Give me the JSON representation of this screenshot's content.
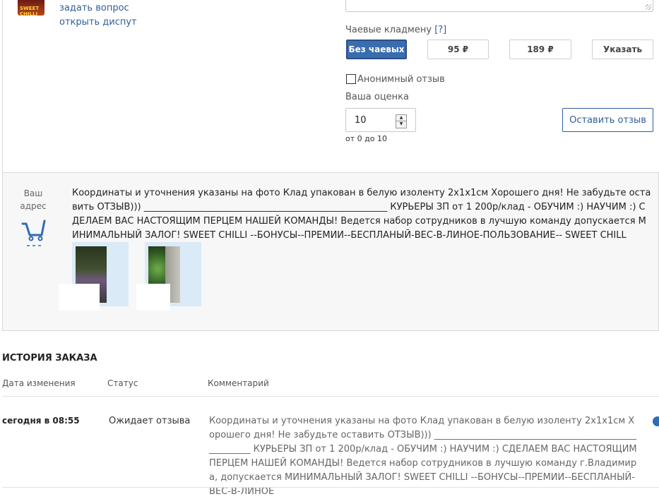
{
  "seller": {
    "avatar_text": "SWEET CHILLI",
    "ask_question": "задать вопрос",
    "open_dispute": "открыть диспут"
  },
  "tips": {
    "label": "Чаевые кладмену",
    "help": "[?]",
    "options": [
      "Без чаевых",
      "95 ₽",
      "189 ₽",
      "Указать"
    ],
    "selected_index": 0
  },
  "review": {
    "anonymous_label": "Анонимный отзыв",
    "rating_label": "Ваша оценка",
    "rating_value": "10",
    "rating_hint": "от 0 до 10",
    "submit_label": "Оставить отзыв"
  },
  "address": {
    "label_line1": "Ваш",
    "label_line2": "адрес",
    "icon": "cart-icon",
    "text": "Координаты и уточнения указаны на фото Клад упакован в белую изоленту 2х1х1см Хорошего дня! Не забудьте оставить ОТЗЫВ))) _____________________________________________________ КУРЬЕРЫ ЗП от 1 200р/клад - ОБУЧИМ :) НАУЧИМ :) СДЕЛАЕМ ВАС НАСТОЯЩИМ ПЕРЦЕМ НАШЕЙ КОМАНДЫ! Ведется набор сотрудников в лучшую команду                        допускается МИНИМАЛЬНЫЙ ЗАЛОГ! SWEET CHILLI --БОНУСЫ--ПРЕМИИ--БЕСПЛАНЫЙ-ВЕС-В-ЛИНОЕ-ПОЛЬЗОВАНИЕ-- SWEET CHILL"
  },
  "history": {
    "title": "ИСТОРИЯ ЗАКАЗА",
    "columns": [
      "Дата изменения",
      "Статус",
      "Комментарий"
    ],
    "rows": [
      {
        "date": "сегодня в 08:55",
        "status": "Ожидает отзыва",
        "comment": "Координаты и уточнения указаны на фото Клад упакован в белую изоленту 2х1х1см Хорошего дня! Не забудьте оставить ОТЗЫВ))) _____________________________________________________ КУРЬЕРЫ ЗП от 1 200р/клад - ОБУЧИМ :) НАУЧИМ :) СДЕЛАЕМ ВАС НАСТОЯЩИМ ПЕРЦЕМ НАШЕЙ КОМАНДЫ! Ведется набор сотрудников в лучшую команду г.Владимира, допускается МИНИМАЛЬНЫЙ ЗАЛОГ! SWEET CHILLI --БОНУСЫ--ПРЕМИИ--БЕСПЛАНЫЙ-ВЕС-В-ЛИНОЕ"
      }
    ]
  },
  "colors": {
    "accent": "#2f5e9c",
    "active_button": "#3a6db0"
  }
}
